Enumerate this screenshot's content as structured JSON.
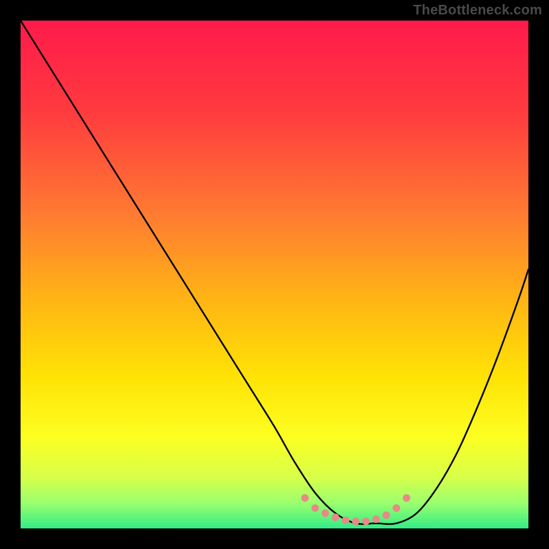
{
  "watermark": "TheBottleneck.com",
  "gradient": {
    "stops": [
      {
        "offset": 0.0,
        "color": "#ff1a4b"
      },
      {
        "offset": 0.18,
        "color": "#ff3b3e"
      },
      {
        "offset": 0.38,
        "color": "#ff7a32"
      },
      {
        "offset": 0.55,
        "color": "#ffb514"
      },
      {
        "offset": 0.7,
        "color": "#ffe205"
      },
      {
        "offset": 0.82,
        "color": "#fcff21"
      },
      {
        "offset": 0.9,
        "color": "#d7ff4a"
      },
      {
        "offset": 0.95,
        "color": "#9bff6e"
      },
      {
        "offset": 1.0,
        "color": "#33ec86"
      }
    ]
  },
  "chart_data": {
    "type": "line",
    "title": "",
    "xlabel": "",
    "ylabel": "",
    "xlim": [
      0,
      100
    ],
    "ylim": [
      0,
      100
    ],
    "series": [
      {
        "name": "bottleneck-curve",
        "x": [
          0,
          5,
          10,
          15,
          20,
          25,
          30,
          35,
          40,
          45,
          50,
          54,
          58,
          62,
          66,
          70,
          74,
          78,
          82,
          86,
          90,
          94,
          98,
          100
        ],
        "values": [
          100,
          92,
          84,
          76,
          68,
          60,
          52,
          44,
          36,
          28,
          20,
          13,
          7,
          3,
          1,
          1,
          1,
          3,
          8,
          15,
          24,
          34,
          45,
          51
        ]
      }
    ],
    "markers": {
      "name": "highlight-band",
      "color": "#e68a87",
      "x": [
        56,
        58,
        60,
        62,
        64,
        66,
        68,
        70,
        72,
        74,
        76
      ],
      "values": [
        6,
        4,
        3,
        2.2,
        1.6,
        1.4,
        1.4,
        1.8,
        2.6,
        4,
        6
      ]
    }
  }
}
